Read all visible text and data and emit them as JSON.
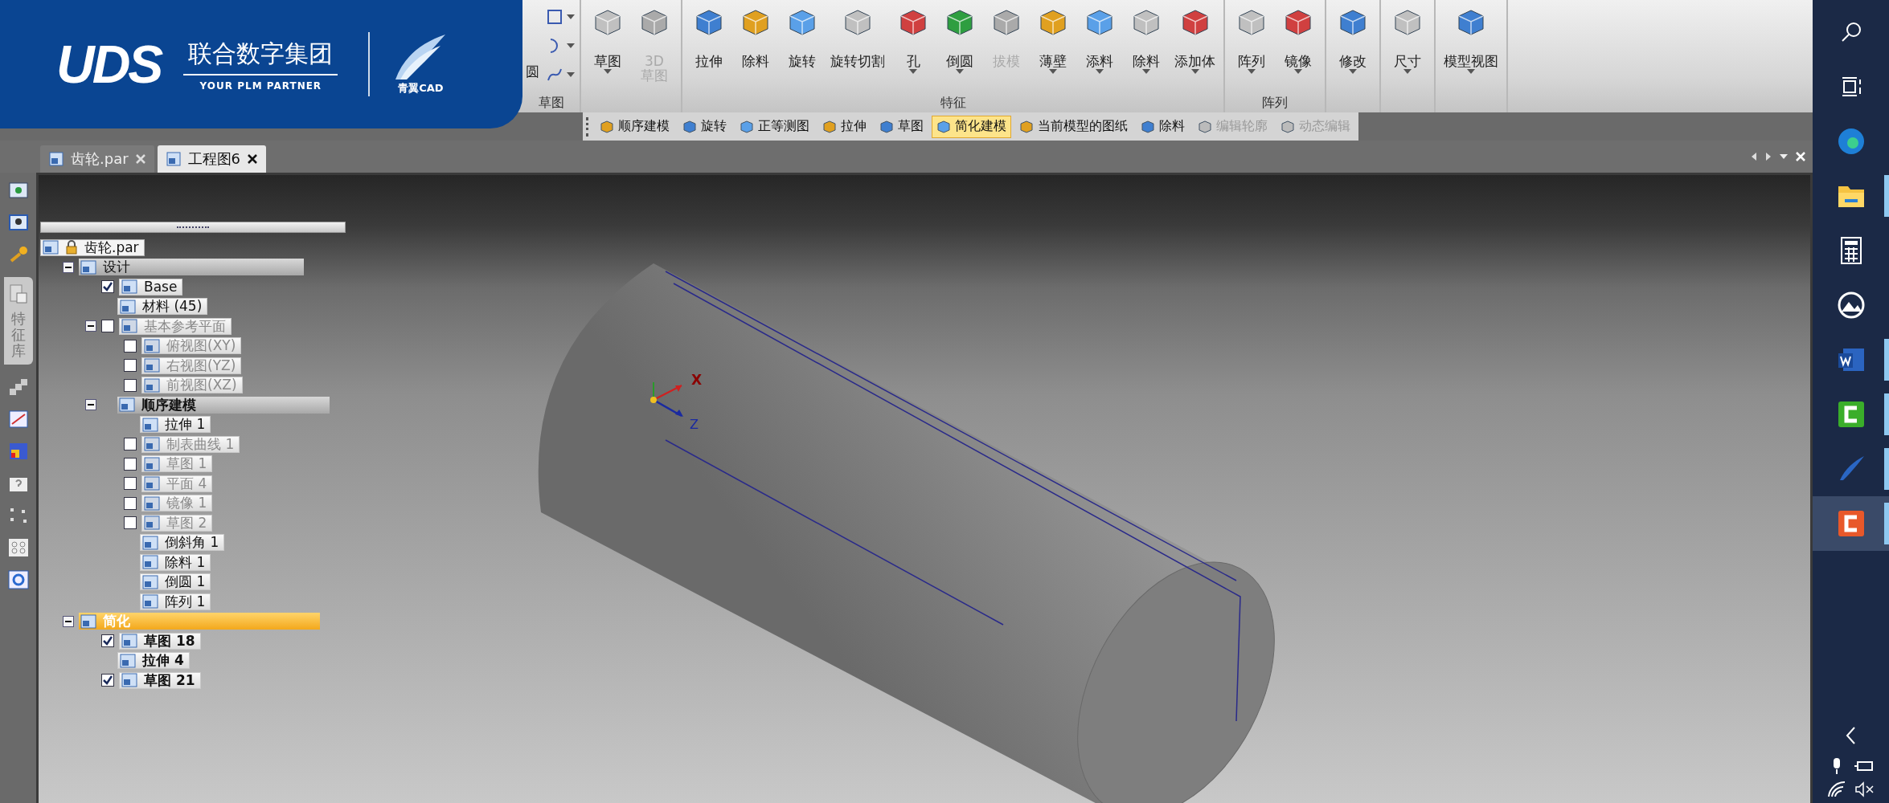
{
  "brand": {
    "logo": "UDS",
    "company": "联合数字集团",
    "tagline": "YOUR PLM PARTNER",
    "product": "青翼CAD"
  },
  "ribbon": {
    "groups": [
      {
        "kind": "small",
        "cut_label": "圆",
        "label": "草图",
        "tools": [
          {
            "has_menu": true
          },
          {
            "has_menu": true
          },
          {
            "has_menu": true
          }
        ]
      },
      {
        "kind": "big",
        "buttons": [
          {
            "label": "草图",
            "disabled": false,
            "has_menu": true
          },
          {
            "label": "3D 草图",
            "disabled": true,
            "has_menu": false
          }
        ]
      },
      {
        "kind": "big",
        "label": "特征",
        "buttons": [
          {
            "label": "拉伸",
            "disabled": false,
            "has_menu": false
          },
          {
            "label": "除料",
            "disabled": false,
            "has_menu": false
          },
          {
            "label": "旋转",
            "disabled": false,
            "has_menu": false
          },
          {
            "label": "旋转切割",
            "disabled": false,
            "has_menu": false
          },
          {
            "label": "孔",
            "disabled": false,
            "has_menu": true
          },
          {
            "label": "倒圆",
            "disabled": false,
            "has_menu": true
          },
          {
            "label": "拔模",
            "disabled": true,
            "has_menu": false
          },
          {
            "label": "薄壁",
            "disabled": false,
            "has_menu": true
          },
          {
            "label": "添料",
            "disabled": false,
            "has_menu": true
          },
          {
            "label": "除料",
            "disabled": false,
            "has_menu": true
          },
          {
            "label": "添加体",
            "disabled": false,
            "has_menu": true
          }
        ]
      },
      {
        "kind": "big",
        "label": "阵列",
        "buttons": [
          {
            "label": "阵列",
            "disabled": false,
            "has_menu": true
          },
          {
            "label": "镜像",
            "disabled": false,
            "has_menu": true
          }
        ]
      },
      {
        "kind": "big",
        "buttons": [
          {
            "label": "修改",
            "disabled": false,
            "has_menu": true
          }
        ]
      },
      {
        "kind": "big",
        "buttons": [
          {
            "label": "尺寸",
            "disabled": false,
            "has_menu": true
          }
        ]
      },
      {
        "kind": "big",
        "buttons": [
          {
            "label": "模型视图",
            "disabled": false,
            "has_menu": true
          }
        ]
      }
    ]
  },
  "quick_toolbar": [
    {
      "label": "顺序建模",
      "selected": false,
      "disabled": false
    },
    {
      "label": "旋转",
      "selected": false,
      "disabled": false
    },
    {
      "label": "正等测图",
      "selected": false,
      "disabled": false
    },
    {
      "label": "拉伸",
      "selected": false,
      "disabled": false
    },
    {
      "label": "草图",
      "selected": false,
      "disabled": false
    },
    {
      "label": "简化建模",
      "selected": true,
      "disabled": false
    },
    {
      "label": "当前模型的图纸",
      "selected": false,
      "disabled": false
    },
    {
      "label": "除料",
      "selected": false,
      "disabled": false
    },
    {
      "label": "编辑轮廓",
      "selected": false,
      "disabled": true
    },
    {
      "label": "动态编辑",
      "selected": false,
      "disabled": true
    }
  ],
  "tabs": [
    {
      "label": "齿轮.par",
      "selected": false
    },
    {
      "label": "工程图6",
      "selected": true
    }
  ],
  "left_strip": {
    "tab_label": "特征库"
  },
  "tree": {
    "label": "齿轮.par",
    "kind": "file",
    "dimmed": false,
    "children": [
      {
        "label": "设计",
        "kind": "group",
        "dimmed": false,
        "expanded": true,
        "children": [
          {
            "label": "Base",
            "kind": "item",
            "dimmed": false,
            "checked": true
          },
          {
            "label": "材料 (45)",
            "kind": "item",
            "dimmed": false
          },
          {
            "label": "基本参考平面",
            "kind": "item",
            "dimmed": true,
            "checked": false,
            "expanded": true,
            "children": [
              {
                "label": "俯视图(XY)",
                "kind": "item",
                "dimmed": true,
                "checked": false
              },
              {
                "label": "右视图(YZ)",
                "kind": "item",
                "dimmed": true,
                "checked": false
              },
              {
                "label": "前视图(XZ)",
                "kind": "item",
                "dimmed": true,
                "checked": false
              }
            ]
          },
          {
            "label": "顺序建模",
            "kind": "section",
            "dimmed": false,
            "expanded": true,
            "children": [
              {
                "label": "拉伸 1",
                "kind": "item",
                "dimmed": false
              },
              {
                "label": "制表曲线 1",
                "kind": "item",
                "dimmed": true,
                "checked": false
              },
              {
                "label": "草图 1",
                "kind": "item",
                "dimmed": true,
                "checked": false
              },
              {
                "label": "平面 4",
                "kind": "item",
                "dimmed": true,
                "checked": false
              },
              {
                "label": "镜像 1",
                "kind": "item",
                "dimmed": true,
                "checked": false
              },
              {
                "label": "草图 2",
                "kind": "item",
                "dimmed": true,
                "checked": false
              },
              {
                "label": "倒斜角 1",
                "kind": "item",
                "dimmed": false
              },
              {
                "label": "除料 1",
                "kind": "item",
                "dimmed": false
              },
              {
                "label": "倒圆 1",
                "kind": "item",
                "dimmed": false
              },
              {
                "label": "阵列 1",
                "kind": "item",
                "dimmed": false
              }
            ]
          }
        ]
      },
      {
        "label": "简化",
        "kind": "highlight",
        "dimmed": false,
        "expanded": true,
        "children": [
          {
            "label": "草图 18",
            "kind": "strong",
            "dimmed": false,
            "checked": true
          },
          {
            "label": "拉伸 4",
            "kind": "strong",
            "dimmed": false
          },
          {
            "label": "草图 21",
            "kind": "strong",
            "dimmed": false,
            "checked": true
          }
        ]
      }
    ]
  },
  "viewport": {
    "axis_labels": [
      "X",
      "Z"
    ]
  },
  "taskbar": {
    "apps": [
      {
        "kind": "browser",
        "running": false,
        "active": false
      },
      {
        "kind": "folder",
        "running": true,
        "active": false
      },
      {
        "kind": "calculator",
        "running": false,
        "active": false
      },
      {
        "kind": "photos",
        "running": false,
        "active": false
      },
      {
        "kind": "document",
        "running": true,
        "active": false
      },
      {
        "kind": "editor",
        "running": true,
        "active": false
      },
      {
        "kind": "wing",
        "running": true,
        "active": false
      },
      {
        "kind": "recorder",
        "running": true,
        "active": true
      }
    ]
  }
}
